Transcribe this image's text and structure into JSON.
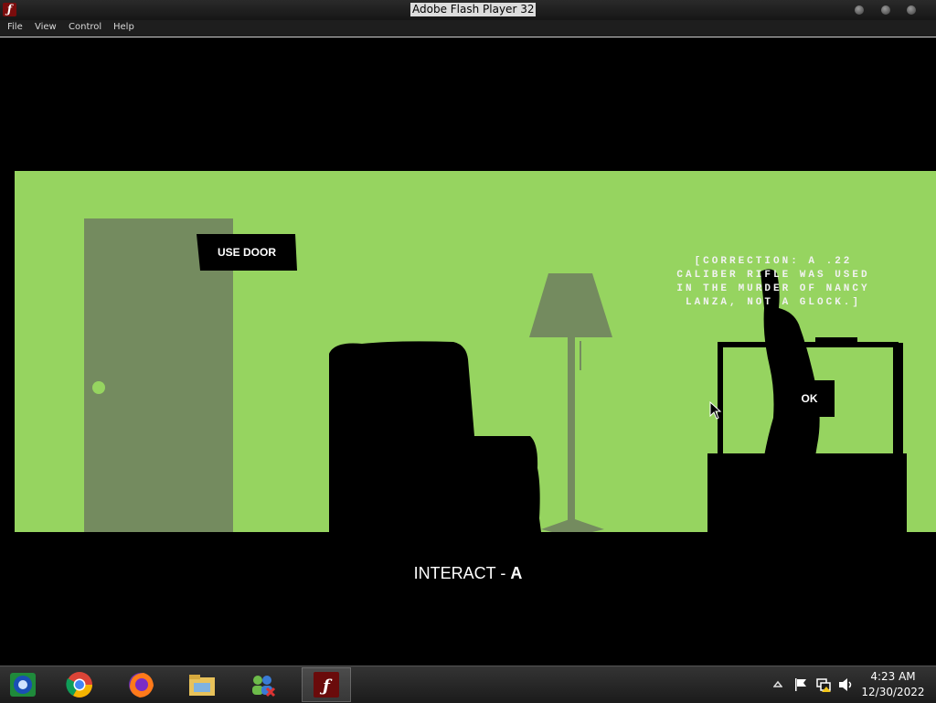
{
  "window": {
    "title": "Adobe Flash Player 32",
    "app_icon": "flash-icon",
    "controls": [
      "minimize-icon",
      "maximize-icon",
      "close-icon"
    ]
  },
  "menubar": {
    "items": [
      "File",
      "View",
      "Control",
      "Help"
    ]
  },
  "game": {
    "use_door_label": "USE DOOR",
    "correction_text": "[CORRECTION: A .22\nCALIBER RIFLE WAS USED\nIN THE MURDER OF NANCY\nLANZA, NOT A GLOCK.]",
    "ok_label": "OK",
    "interact_prefix": "INTERACT - ",
    "interact_key": "A",
    "colors": {
      "wall": "#96d460",
      "door": "#748b5f",
      "lamp": "#748b5f",
      "silhouette": "#000000"
    }
  },
  "taskbar": {
    "pinned": [
      "windows-media-center-icon",
      "chrome-icon",
      "firefox-icon",
      "file-explorer-icon",
      "messenger-icon",
      "flash-player-icon"
    ],
    "tray_icons": [
      "show-hidden-icons-arrow",
      "action-center-flag-icon",
      "network-icon",
      "volume-icon"
    ],
    "time": "4:23 AM",
    "date": "12/30/2022"
  }
}
